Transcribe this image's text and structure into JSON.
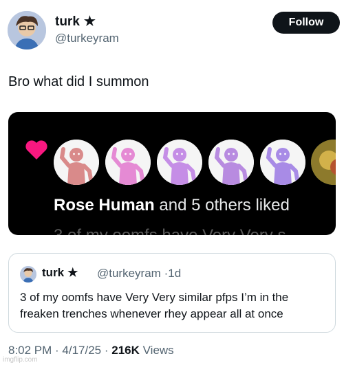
{
  "author": {
    "name": "turk",
    "star": "★",
    "handle": "@turkeyram",
    "follow_label": "Follow"
  },
  "tweet": {
    "text": "Bro what did I summon"
  },
  "media": {
    "liked_name": "Rose Human",
    "liked_rest": " and 5 others liked",
    "faded_text": "3 of my oomfs have Very Very s",
    "pfp_colors": [
      "#d98a8a",
      "#e58ad4",
      "#c58ee6",
      "#b88be0",
      "#a88be6"
    ]
  },
  "quote": {
    "name": "turk",
    "star": "★",
    "handle": "@turkeyram",
    "dot": "·",
    "time": "1d",
    "text": "3 of my oomfs have Very Very similar pfps I’m in the freaken trenches whenever rhey appear all at once"
  },
  "footer": {
    "time": "8:02 PM",
    "sep1": " · ",
    "date": "4/17/25",
    "sep2": " · ",
    "views_count": "216K",
    "views_label": " Views"
  },
  "watermark": "imgflip.com"
}
